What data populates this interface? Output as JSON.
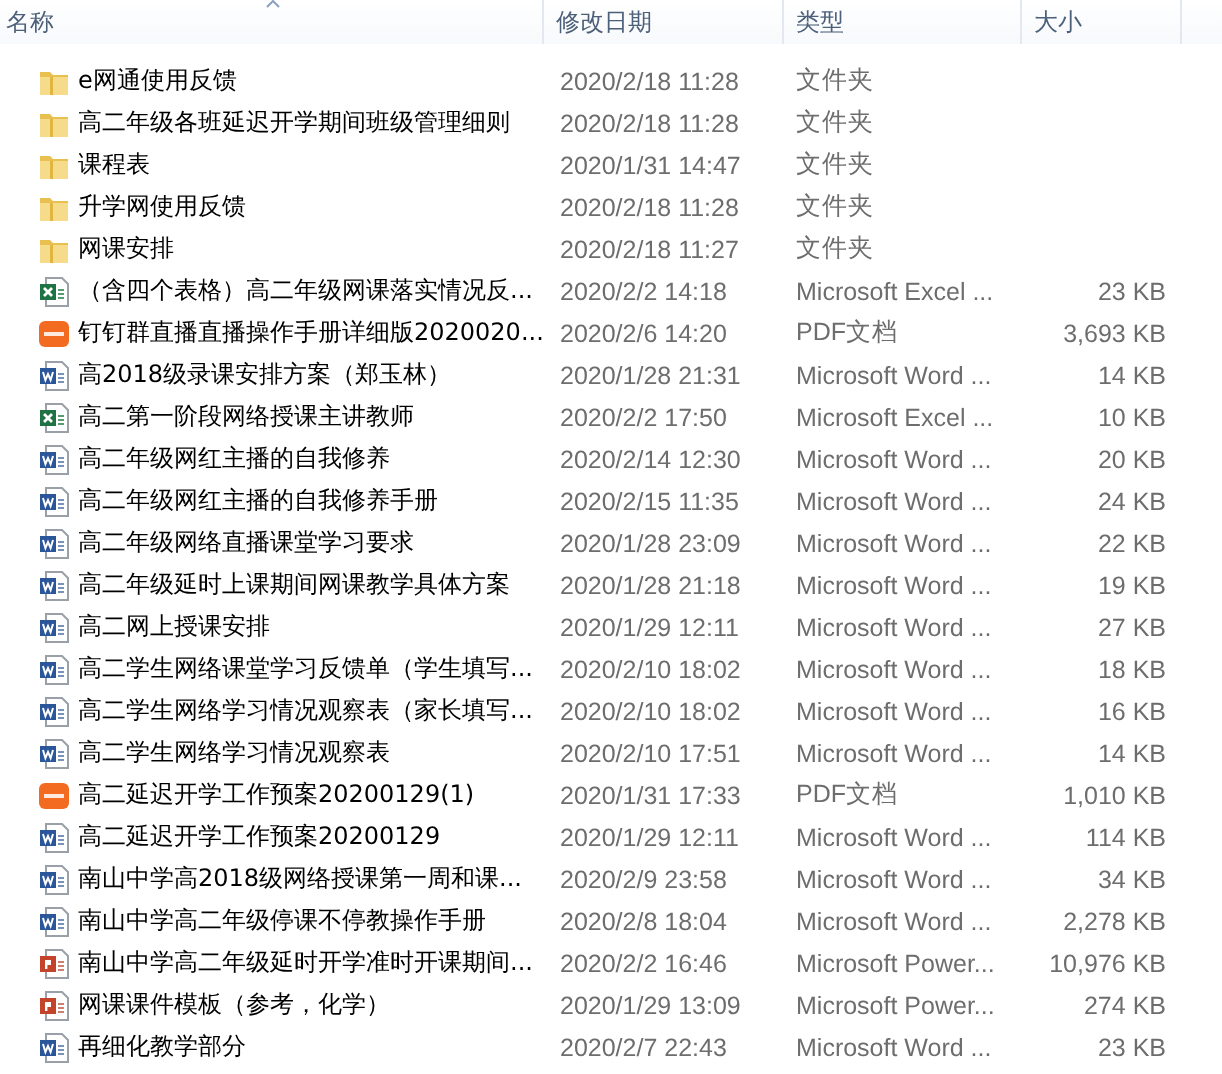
{
  "columns": [
    {
      "label": "名称",
      "sorted": true
    },
    {
      "label": "修改日期",
      "sorted": false
    },
    {
      "label": "类型",
      "sorted": false
    },
    {
      "label": "大小",
      "sorted": false
    }
  ],
  "files": [
    {
      "kind": "folder",
      "name": "e网通使用反馈",
      "date": "2020/2/18 11:28",
      "type": "文件夹"
    },
    {
      "kind": "folder",
      "name": "高二年级各班延迟开学期间班级管理细则",
      "date": "2020/2/18 11:28",
      "type": "文件夹"
    },
    {
      "kind": "folder",
      "name": "课程表",
      "date": "2020/1/31 14:47",
      "type": "文件夹"
    },
    {
      "kind": "folder",
      "name": "升学网使用反馈",
      "date": "2020/2/18 11:28",
      "type": "文件夹"
    },
    {
      "kind": "folder",
      "name": "网课安排",
      "date": "2020/2/18 11:27",
      "type": "文件夹"
    },
    {
      "kind": "excel",
      "name": "（含四个表格）高二年级网课落实情况反...",
      "date": "2020/2/2 14:18",
      "type": "Microsoft Excel ...",
      "size": "23 KB"
    },
    {
      "kind": "pdf",
      "name": "钉钉群直播直播操作手册详细版2020020...",
      "date": "2020/2/6 14:20",
      "type": "PDF文档",
      "size": "3,693 KB"
    },
    {
      "kind": "word",
      "name": "高2018级录课安排方案（郑玉林）",
      "date": "2020/1/28 21:31",
      "type": "Microsoft Word ...",
      "size": "14 KB"
    },
    {
      "kind": "excel",
      "name": "高二第一阶段网络授课主讲教师",
      "date": "2020/2/2 17:50",
      "type": "Microsoft Excel ...",
      "size": "10 KB"
    },
    {
      "kind": "word",
      "name": "高二年级网红主播的自我修养",
      "date": "2020/2/14 12:30",
      "type": "Microsoft Word ...",
      "size": "20 KB"
    },
    {
      "kind": "word",
      "name": "高二年级网红主播的自我修养手册",
      "date": "2020/2/15 11:35",
      "type": "Microsoft Word ...",
      "size": "24 KB"
    },
    {
      "kind": "word",
      "name": "高二年级网络直播课堂学习要求",
      "date": "2020/1/28 23:09",
      "type": "Microsoft Word ...",
      "size": "22 KB"
    },
    {
      "kind": "word",
      "name": "高二年级延时上课期间网课教学具体方案",
      "date": "2020/1/28 21:18",
      "type": "Microsoft Word ...",
      "size": "19 KB"
    },
    {
      "kind": "word",
      "name": "高二网上授课安排",
      "date": "2020/1/29 12:11",
      "type": "Microsoft Word ...",
      "size": "27 KB"
    },
    {
      "kind": "word",
      "name": "高二学生网络课堂学习反馈单（学生填写...",
      "date": "2020/2/10 18:02",
      "type": "Microsoft Word ...",
      "size": "18 KB"
    },
    {
      "kind": "word",
      "name": "高二学生网络学习情况观察表（家长填写...",
      "date": "2020/2/10 18:02",
      "type": "Microsoft Word ...",
      "size": "16 KB"
    },
    {
      "kind": "word",
      "name": "高二学生网络学习情况观察表",
      "date": "2020/2/10 17:51",
      "type": "Microsoft Word ...",
      "size": "14 KB"
    },
    {
      "kind": "pdf",
      "name": "高二延迟开学工作预案20200129(1)",
      "date": "2020/1/31 17:33",
      "type": "PDF文档",
      "size": "1,010 KB"
    },
    {
      "kind": "word",
      "name": "高二延迟开学工作预案20200129",
      "date": "2020/1/29 12:11",
      "type": "Microsoft Word ...",
      "size": "114 KB"
    },
    {
      "kind": "word",
      "name": "南山中学高2018级网络授课第一周和课...",
      "date": "2020/2/9 23:58",
      "type": "Microsoft Word ...",
      "size": "34 KB"
    },
    {
      "kind": "word",
      "name": "南山中学高二年级停课不停教操作手册",
      "date": "2020/2/8 18:04",
      "type": "Microsoft Word ...",
      "size": "2,278 KB"
    },
    {
      "kind": "powerpoint",
      "name": "南山中学高二年级延时开学准时开课期间...",
      "date": "2020/2/2 16:46",
      "type": "Microsoft Power...",
      "size": "10,976 KB"
    },
    {
      "kind": "powerpoint",
      "name": "网课课件模板（参考，化学）",
      "date": "2020/1/29 13:09",
      "type": "Microsoft Power...",
      "size": "274 KB"
    },
    {
      "kind": "word",
      "name": "再细化教学部分",
      "date": "2020/2/7 22:43",
      "type": "Microsoft Word ...",
      "size": "23 KB"
    }
  ]
}
